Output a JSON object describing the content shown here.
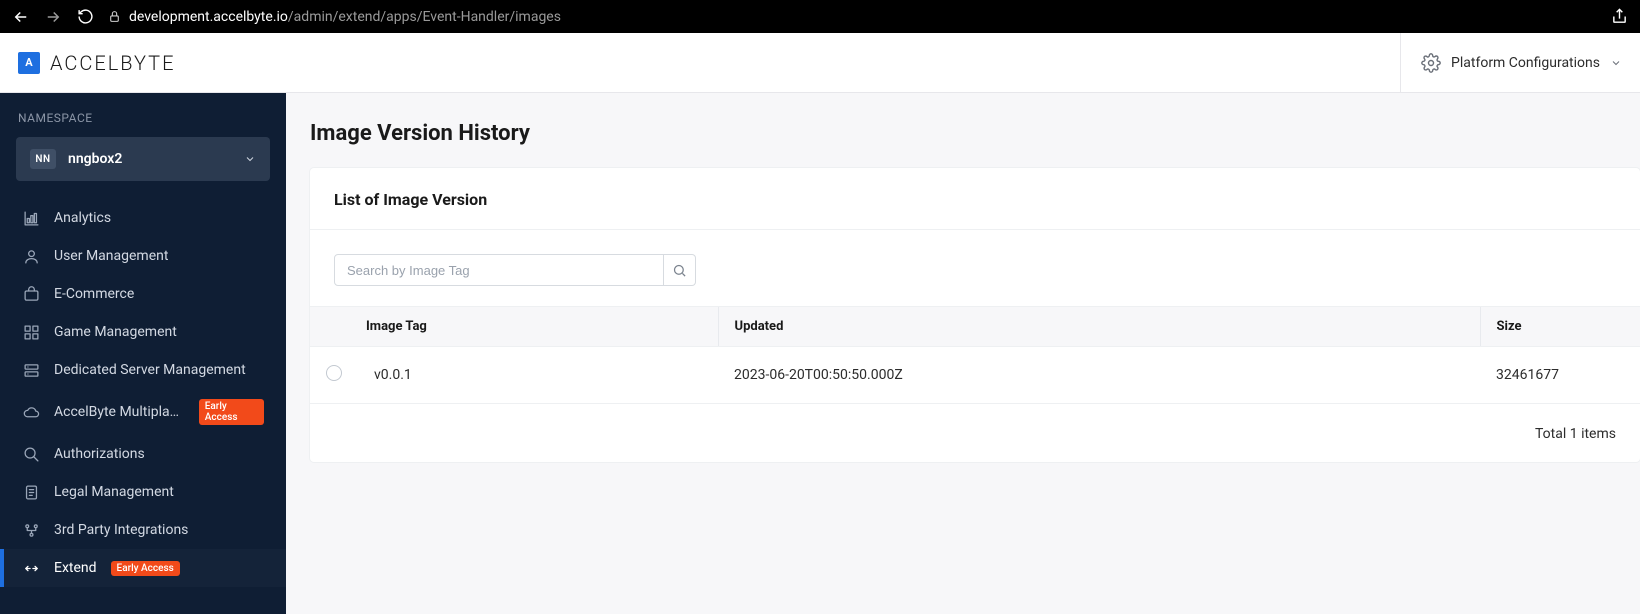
{
  "browser": {
    "host": "development.accelbyte.io",
    "path": "/admin/extend/apps/Event-Handler/images"
  },
  "brand": {
    "mark": "A",
    "name": "ACCELBYTE"
  },
  "topbar": {
    "platform_cfg": "Platform Configurations"
  },
  "sidebar": {
    "ns_label": "NAMESPACE",
    "ns_badge": "NN",
    "ns_name": "nngbox2",
    "early_access": "Early Access",
    "items": [
      {
        "label": "Analytics",
        "icon": "chart"
      },
      {
        "label": "User Management",
        "icon": "user"
      },
      {
        "label": "E-Commerce",
        "icon": "cart"
      },
      {
        "label": "Game Management",
        "icon": "grid"
      },
      {
        "label": "Dedicated Server Management",
        "icon": "server"
      },
      {
        "label": "AccelByte Multiplaye...",
        "icon": "cloud",
        "badge": true
      },
      {
        "label": "Authorizations",
        "icon": "key"
      },
      {
        "label": "Legal Management",
        "icon": "doc"
      },
      {
        "label": "3rd Party Integrations",
        "icon": "integrations"
      },
      {
        "label": "Extend",
        "icon": "extend",
        "badge": true,
        "active": true
      }
    ]
  },
  "main": {
    "page_title": "Image Version History",
    "card_title": "List of Image Version",
    "search_placeholder": "Search by Image Tag",
    "columns": {
      "tag": "Image Tag",
      "updated": "Updated",
      "size": "Size"
    },
    "rows": [
      {
        "tag": "v0.0.1",
        "updated": "2023-06-20T00:50:50.000Z",
        "size": "32461677"
      }
    ],
    "pager": "Total 1 items"
  }
}
